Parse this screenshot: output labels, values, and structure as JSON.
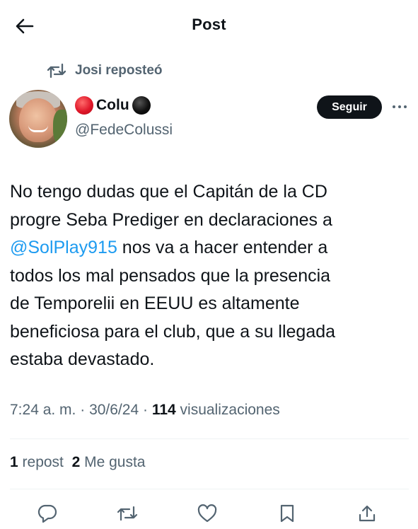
{
  "header": {
    "title": "Post"
  },
  "repost": {
    "text": "Josi reposteó"
  },
  "author": {
    "display_name": "Colu",
    "handle": "@FedeColussi",
    "follow_label": "Seguir"
  },
  "tweet": {
    "line1": "No tengo dudas que el Capitán de la CD",
    "line2": "progre Seba Prediger en declaraciones a",
    "mention": "@SolPlay915",
    "line3_rest": " nos va a hacer entender a",
    "line4": "todos los mal pensados que la presencia",
    "line5": "de Temporelii en EEUU es altamente",
    "line6": "beneficiosa para el club, que a su llegada",
    "line7": "estaba devastado."
  },
  "meta": {
    "time": "7:24 a. m.",
    "sep1": " · ",
    "date": "30/6/24",
    "sep2": " · ",
    "views_count": "114",
    "views_label": " visualizaciones"
  },
  "stats": {
    "reposts_count": "1",
    "reposts_label": " repost",
    "likes_count": "2",
    "likes_label": " Me gusta"
  },
  "icons": {
    "back": "arrow-left-icon",
    "repost": "repost-icon",
    "more": "more-horizontal-icon",
    "reply": "reply-icon",
    "retweet": "repost-icon",
    "like": "heart-icon",
    "bookmark": "bookmark-icon",
    "share": "share-icon"
  },
  "colors": {
    "text": "#0f1419",
    "secondary": "#536471",
    "link": "#1d9bf0",
    "follow_bg": "#0f1419"
  }
}
